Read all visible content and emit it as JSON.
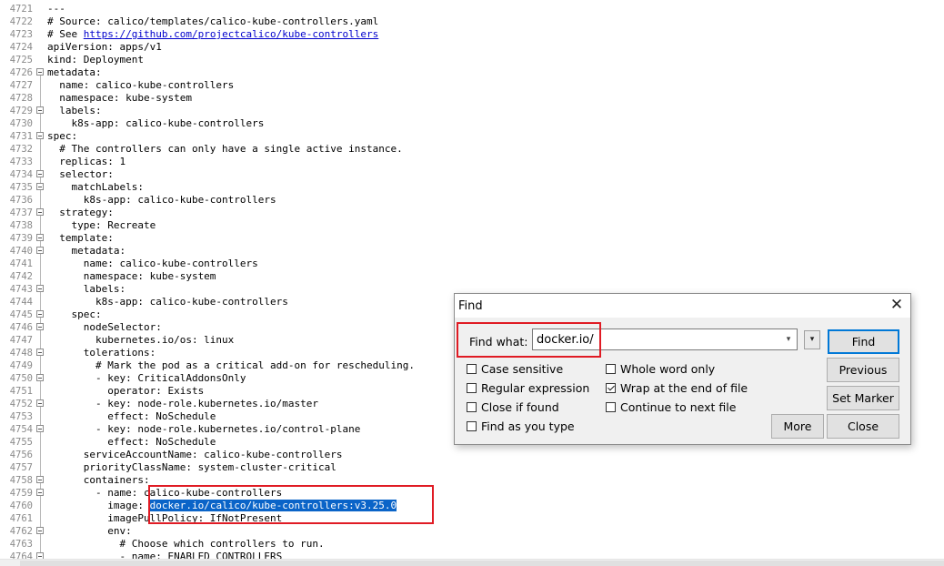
{
  "editor": {
    "lines": [
      {
        "n": "4721",
        "text": "---",
        "fold": false
      },
      {
        "n": "4722",
        "text": "# Source: calico/templates/calico-kube-controllers.yaml",
        "fold": false
      },
      {
        "n": "4723",
        "text": "# See ",
        "link": "https://github.com/projectcalico/kube-controllers",
        "fold": false
      },
      {
        "n": "4724",
        "text": "apiVersion: apps/v1",
        "fold": false
      },
      {
        "n": "4725",
        "text": "kind: Deployment",
        "fold": false
      },
      {
        "n": "4726",
        "text": "metadata:",
        "fold": true
      },
      {
        "n": "4727",
        "text": "  name: calico-kube-controllers",
        "fold": false
      },
      {
        "n": "4728",
        "text": "  namespace: kube-system",
        "fold": false
      },
      {
        "n": "4729",
        "text": "  labels:",
        "fold": true
      },
      {
        "n": "4730",
        "text": "    k8s-app: calico-kube-controllers",
        "fold": false
      },
      {
        "n": "4731",
        "text": "spec:",
        "fold": true
      },
      {
        "n": "4732",
        "text": "  # The controllers can only have a single active instance.",
        "fold": false
      },
      {
        "n": "4733",
        "text": "  replicas: 1",
        "fold": false
      },
      {
        "n": "4734",
        "text": "  selector:",
        "fold": true
      },
      {
        "n": "4735",
        "text": "    matchLabels:",
        "fold": true
      },
      {
        "n": "4736",
        "text": "      k8s-app: calico-kube-controllers",
        "fold": false
      },
      {
        "n": "4737",
        "text": "  strategy:",
        "fold": true
      },
      {
        "n": "4738",
        "text": "    type: Recreate",
        "fold": false
      },
      {
        "n": "4739",
        "text": "  template:",
        "fold": true
      },
      {
        "n": "4740",
        "text": "    metadata:",
        "fold": true
      },
      {
        "n": "4741",
        "text": "      name: calico-kube-controllers",
        "fold": false
      },
      {
        "n": "4742",
        "text": "      namespace: kube-system",
        "fold": false
      },
      {
        "n": "4743",
        "text": "      labels:",
        "fold": true
      },
      {
        "n": "4744",
        "text": "        k8s-app: calico-kube-controllers",
        "fold": false
      },
      {
        "n": "4745",
        "text": "    spec:",
        "fold": true
      },
      {
        "n": "4746",
        "text": "      nodeSelector:",
        "fold": true
      },
      {
        "n": "4747",
        "text": "        kubernetes.io/os: linux",
        "fold": false
      },
      {
        "n": "4748",
        "text": "      tolerations:",
        "fold": true
      },
      {
        "n": "4749",
        "text": "        # Mark the pod as a critical add-on for rescheduling.",
        "fold": false
      },
      {
        "n": "4750",
        "text": "        - key: CriticalAddonsOnly",
        "fold": true
      },
      {
        "n": "4751",
        "text": "          operator: Exists",
        "fold": false
      },
      {
        "n": "4752",
        "text": "        - key: node-role.kubernetes.io/master",
        "fold": true
      },
      {
        "n": "4753",
        "text": "          effect: NoSchedule",
        "fold": false
      },
      {
        "n": "4754",
        "text": "        - key: node-role.kubernetes.io/control-plane",
        "fold": true
      },
      {
        "n": "4755",
        "text": "          effect: NoSchedule",
        "fold": false
      },
      {
        "n": "4756",
        "text": "      serviceAccountName: calico-kube-controllers",
        "fold": false
      },
      {
        "n": "4757",
        "text": "      priorityClassName: system-cluster-critical",
        "fold": false
      },
      {
        "n": "4758",
        "text": "      containers:",
        "fold": true
      },
      {
        "n": "4759",
        "text": "        - name: calico-kube-controllers",
        "fold": true
      },
      {
        "n": "4760",
        "text": "          image: ",
        "selected": "docker.io/calico/kube-controllers:v3.25.0",
        "fold": false
      },
      {
        "n": "4761",
        "text": "          imagePullPolicy: IfNotPresent",
        "fold": false
      },
      {
        "n": "4762",
        "text": "          env:",
        "fold": true
      },
      {
        "n": "4763",
        "text": "            # Choose which controllers to run.",
        "fold": false
      },
      {
        "n": "4764",
        "text": "            - name: ENABLED_CONTROLLERS",
        "fold": true
      }
    ]
  },
  "find_dialog": {
    "title": "Find",
    "close_glyph": "✕",
    "find_what_label": "Find what:",
    "find_value": "docker.io/",
    "dropdown_glyph": "▾",
    "history_glyph": "▾",
    "options": {
      "case_sensitive": {
        "label": "Case sensitive",
        "checked": false
      },
      "regular_expression": {
        "label": "Regular expression",
        "checked": false
      },
      "close_if_found": {
        "label": "Close if found",
        "checked": false
      },
      "find_as_you_type": {
        "label": "Find as you type",
        "checked": false
      },
      "whole_word_only": {
        "label": "Whole word only",
        "checked": false
      },
      "wrap_at_end": {
        "label": "Wrap at the end of file",
        "checked": true
      },
      "continue_next_file": {
        "label": "Continue to next file",
        "checked": false
      }
    },
    "buttons": {
      "find": "Find",
      "previous": "Previous",
      "set_marker": "Set Marker",
      "more": "More",
      "close": "Close"
    }
  },
  "colors": {
    "selection": "#0a64c8",
    "annotation_box": "#e01b24",
    "link": "#0000cc"
  }
}
